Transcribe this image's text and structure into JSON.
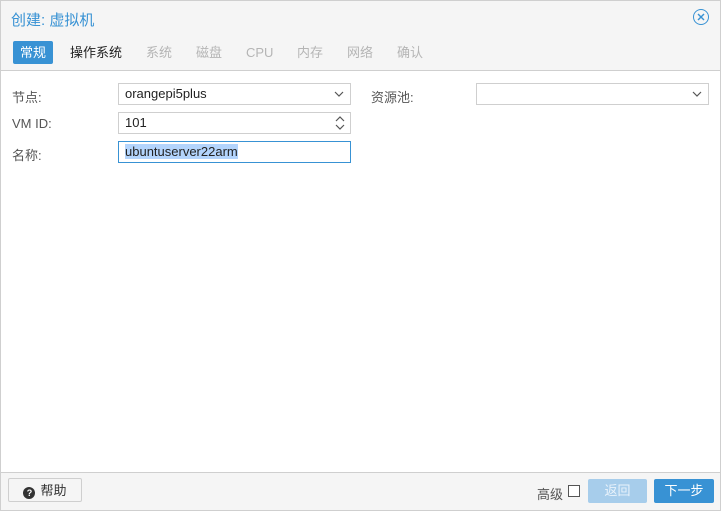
{
  "dialog": {
    "title": "创建: 虚拟机"
  },
  "tabs": [
    {
      "label": "常规",
      "state": "active"
    },
    {
      "label": "操作系统",
      "state": "normal"
    },
    {
      "label": "系统",
      "state": "disabled"
    },
    {
      "label": "磁盘",
      "state": "disabled"
    },
    {
      "label": "CPU",
      "state": "disabled"
    },
    {
      "label": "内存",
      "state": "disabled"
    },
    {
      "label": "网络",
      "state": "disabled"
    },
    {
      "label": "确认",
      "state": "disabled"
    }
  ],
  "form": {
    "node": {
      "label": "节点:",
      "value": "orangepi5plus"
    },
    "vmid": {
      "label": "VM ID:",
      "value": "101"
    },
    "name": {
      "label": "名称:",
      "value": "ubuntuserver22arm"
    },
    "pool": {
      "label": "资源池:",
      "value": ""
    }
  },
  "footer": {
    "help_label": "帮助",
    "advanced_label": "高级",
    "advanced_checked": false,
    "back_label": "返回",
    "next_label": "下一步"
  },
  "colors": {
    "accent": "#3892d4",
    "disabled_tab": "#b5b5b5",
    "back_button_disabled": "#a7cdeb"
  },
  "icons": {
    "close": "close-circle-icon",
    "help": "question-circle-icon",
    "dropdown": "chevron-down-icon",
    "spinner": "spinner-arrows-icon"
  }
}
